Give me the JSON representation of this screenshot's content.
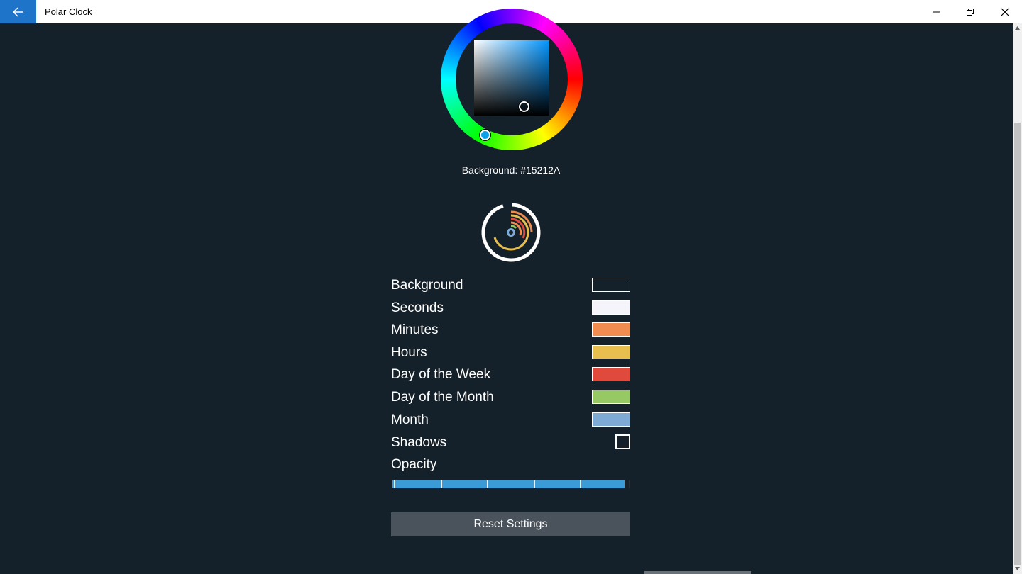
{
  "window": {
    "title": "Polar Clock",
    "accent": "#1e74c8",
    "back_icon": "arrow-left-icon",
    "minimize_icon": "minimize-icon",
    "maximize_icon": "restore-icon",
    "close_icon": "close-icon"
  },
  "color_picker": {
    "current_label": "Background: #15212A",
    "current_color": "#15212A"
  },
  "settings": {
    "items": [
      {
        "label": "Background",
        "color": "#15212A"
      },
      {
        "label": "Seconds",
        "color": "#F4F4FA"
      },
      {
        "label": "Minutes",
        "color": "#F08C50"
      },
      {
        "label": "Hours",
        "color": "#E8BE4E"
      },
      {
        "label": "Day of the Week",
        "color": "#E04A3C"
      },
      {
        "label": "Day of the Month",
        "color": "#96C864"
      },
      {
        "label": "Month",
        "color": "#7EAAD6"
      }
    ],
    "shadows_label": "Shadows",
    "shadows_checked": false,
    "opacity_label": "Opacity",
    "opacity_value": 0.98,
    "opacity_ticks": 5
  },
  "reset_button": {
    "label": "Reset Settings"
  }
}
